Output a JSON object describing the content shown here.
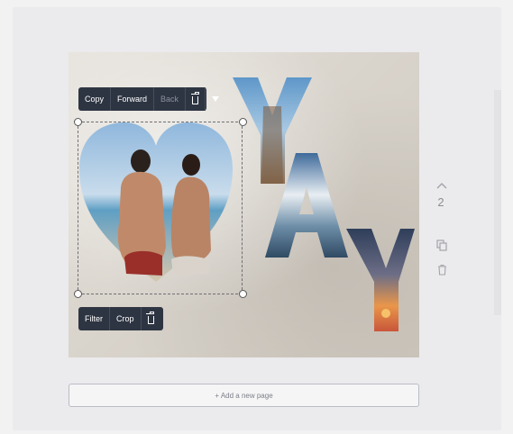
{
  "toolbar_top": {
    "copy_label": "Copy",
    "forward_label": "Forward",
    "back_label": "Back",
    "delete_icon": "trash-icon",
    "more_icon": "caret-down-icon"
  },
  "toolbar_bottom": {
    "filter_label": "Filter",
    "crop_label": "Crop",
    "delete_icon": "trash-icon"
  },
  "canvas": {
    "text_letters": [
      "Y",
      "A",
      "Y"
    ]
  },
  "side_controls": {
    "up_icon": "chevron-up-icon",
    "page_number": "2",
    "duplicate_icon": "duplicate-icon",
    "delete_icon": "trash-icon"
  },
  "add_page_label": "+ Add a new page",
  "colors": {
    "toolbar_bg": "#2e3542",
    "canvas_bg": "#d9d4cc"
  }
}
